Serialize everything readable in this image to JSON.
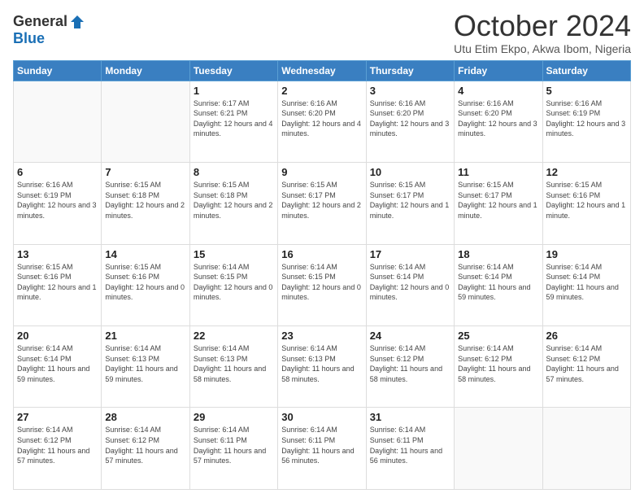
{
  "header": {
    "logo_general": "General",
    "logo_blue": "Blue",
    "month_title": "October 2024",
    "location": "Utu Etim Ekpo, Akwa Ibom, Nigeria"
  },
  "weekdays": [
    "Sunday",
    "Monday",
    "Tuesday",
    "Wednesday",
    "Thursday",
    "Friday",
    "Saturday"
  ],
  "weeks": [
    [
      {
        "day": "",
        "sunrise": "",
        "sunset": "",
        "daylight": ""
      },
      {
        "day": "",
        "sunrise": "",
        "sunset": "",
        "daylight": ""
      },
      {
        "day": "1",
        "sunrise": "Sunrise: 6:17 AM",
        "sunset": "Sunset: 6:21 PM",
        "daylight": "Daylight: 12 hours and 4 minutes."
      },
      {
        "day": "2",
        "sunrise": "Sunrise: 6:16 AM",
        "sunset": "Sunset: 6:20 PM",
        "daylight": "Daylight: 12 hours and 4 minutes."
      },
      {
        "day": "3",
        "sunrise": "Sunrise: 6:16 AM",
        "sunset": "Sunset: 6:20 PM",
        "daylight": "Daylight: 12 hours and 3 minutes."
      },
      {
        "day": "4",
        "sunrise": "Sunrise: 6:16 AM",
        "sunset": "Sunset: 6:20 PM",
        "daylight": "Daylight: 12 hours and 3 minutes."
      },
      {
        "day": "5",
        "sunrise": "Sunrise: 6:16 AM",
        "sunset": "Sunset: 6:19 PM",
        "daylight": "Daylight: 12 hours and 3 minutes."
      }
    ],
    [
      {
        "day": "6",
        "sunrise": "Sunrise: 6:16 AM",
        "sunset": "Sunset: 6:19 PM",
        "daylight": "Daylight: 12 hours and 3 minutes."
      },
      {
        "day": "7",
        "sunrise": "Sunrise: 6:15 AM",
        "sunset": "Sunset: 6:18 PM",
        "daylight": "Daylight: 12 hours and 2 minutes."
      },
      {
        "day": "8",
        "sunrise": "Sunrise: 6:15 AM",
        "sunset": "Sunset: 6:18 PM",
        "daylight": "Daylight: 12 hours and 2 minutes."
      },
      {
        "day": "9",
        "sunrise": "Sunrise: 6:15 AM",
        "sunset": "Sunset: 6:17 PM",
        "daylight": "Daylight: 12 hours and 2 minutes."
      },
      {
        "day": "10",
        "sunrise": "Sunrise: 6:15 AM",
        "sunset": "Sunset: 6:17 PM",
        "daylight": "Daylight: 12 hours and 1 minute."
      },
      {
        "day": "11",
        "sunrise": "Sunrise: 6:15 AM",
        "sunset": "Sunset: 6:17 PM",
        "daylight": "Daylight: 12 hours and 1 minute."
      },
      {
        "day": "12",
        "sunrise": "Sunrise: 6:15 AM",
        "sunset": "Sunset: 6:16 PM",
        "daylight": "Daylight: 12 hours and 1 minute."
      }
    ],
    [
      {
        "day": "13",
        "sunrise": "Sunrise: 6:15 AM",
        "sunset": "Sunset: 6:16 PM",
        "daylight": "Daylight: 12 hours and 1 minute."
      },
      {
        "day": "14",
        "sunrise": "Sunrise: 6:15 AM",
        "sunset": "Sunset: 6:16 PM",
        "daylight": "Daylight: 12 hours and 0 minutes."
      },
      {
        "day": "15",
        "sunrise": "Sunrise: 6:14 AM",
        "sunset": "Sunset: 6:15 PM",
        "daylight": "Daylight: 12 hours and 0 minutes."
      },
      {
        "day": "16",
        "sunrise": "Sunrise: 6:14 AM",
        "sunset": "Sunset: 6:15 PM",
        "daylight": "Daylight: 12 hours and 0 minutes."
      },
      {
        "day": "17",
        "sunrise": "Sunrise: 6:14 AM",
        "sunset": "Sunset: 6:14 PM",
        "daylight": "Daylight: 12 hours and 0 minutes."
      },
      {
        "day": "18",
        "sunrise": "Sunrise: 6:14 AM",
        "sunset": "Sunset: 6:14 PM",
        "daylight": "Daylight: 11 hours and 59 minutes."
      },
      {
        "day": "19",
        "sunrise": "Sunrise: 6:14 AM",
        "sunset": "Sunset: 6:14 PM",
        "daylight": "Daylight: 11 hours and 59 minutes."
      }
    ],
    [
      {
        "day": "20",
        "sunrise": "Sunrise: 6:14 AM",
        "sunset": "Sunset: 6:14 PM",
        "daylight": "Daylight: 11 hours and 59 minutes."
      },
      {
        "day": "21",
        "sunrise": "Sunrise: 6:14 AM",
        "sunset": "Sunset: 6:13 PM",
        "daylight": "Daylight: 11 hours and 59 minutes."
      },
      {
        "day": "22",
        "sunrise": "Sunrise: 6:14 AM",
        "sunset": "Sunset: 6:13 PM",
        "daylight": "Daylight: 11 hours and 58 minutes."
      },
      {
        "day": "23",
        "sunrise": "Sunrise: 6:14 AM",
        "sunset": "Sunset: 6:13 PM",
        "daylight": "Daylight: 11 hours and 58 minutes."
      },
      {
        "day": "24",
        "sunrise": "Sunrise: 6:14 AM",
        "sunset": "Sunset: 6:12 PM",
        "daylight": "Daylight: 11 hours and 58 minutes."
      },
      {
        "day": "25",
        "sunrise": "Sunrise: 6:14 AM",
        "sunset": "Sunset: 6:12 PM",
        "daylight": "Daylight: 11 hours and 58 minutes."
      },
      {
        "day": "26",
        "sunrise": "Sunrise: 6:14 AM",
        "sunset": "Sunset: 6:12 PM",
        "daylight": "Daylight: 11 hours and 57 minutes."
      }
    ],
    [
      {
        "day": "27",
        "sunrise": "Sunrise: 6:14 AM",
        "sunset": "Sunset: 6:12 PM",
        "daylight": "Daylight: 11 hours and 57 minutes."
      },
      {
        "day": "28",
        "sunrise": "Sunrise: 6:14 AM",
        "sunset": "Sunset: 6:12 PM",
        "daylight": "Daylight: 11 hours and 57 minutes."
      },
      {
        "day": "29",
        "sunrise": "Sunrise: 6:14 AM",
        "sunset": "Sunset: 6:11 PM",
        "daylight": "Daylight: 11 hours and 57 minutes."
      },
      {
        "day": "30",
        "sunrise": "Sunrise: 6:14 AM",
        "sunset": "Sunset: 6:11 PM",
        "daylight": "Daylight: 11 hours and 56 minutes."
      },
      {
        "day": "31",
        "sunrise": "Sunrise: 6:14 AM",
        "sunset": "Sunset: 6:11 PM",
        "daylight": "Daylight: 11 hours and 56 minutes."
      },
      {
        "day": "",
        "sunrise": "",
        "sunset": "",
        "daylight": ""
      },
      {
        "day": "",
        "sunrise": "",
        "sunset": "",
        "daylight": ""
      }
    ]
  ]
}
